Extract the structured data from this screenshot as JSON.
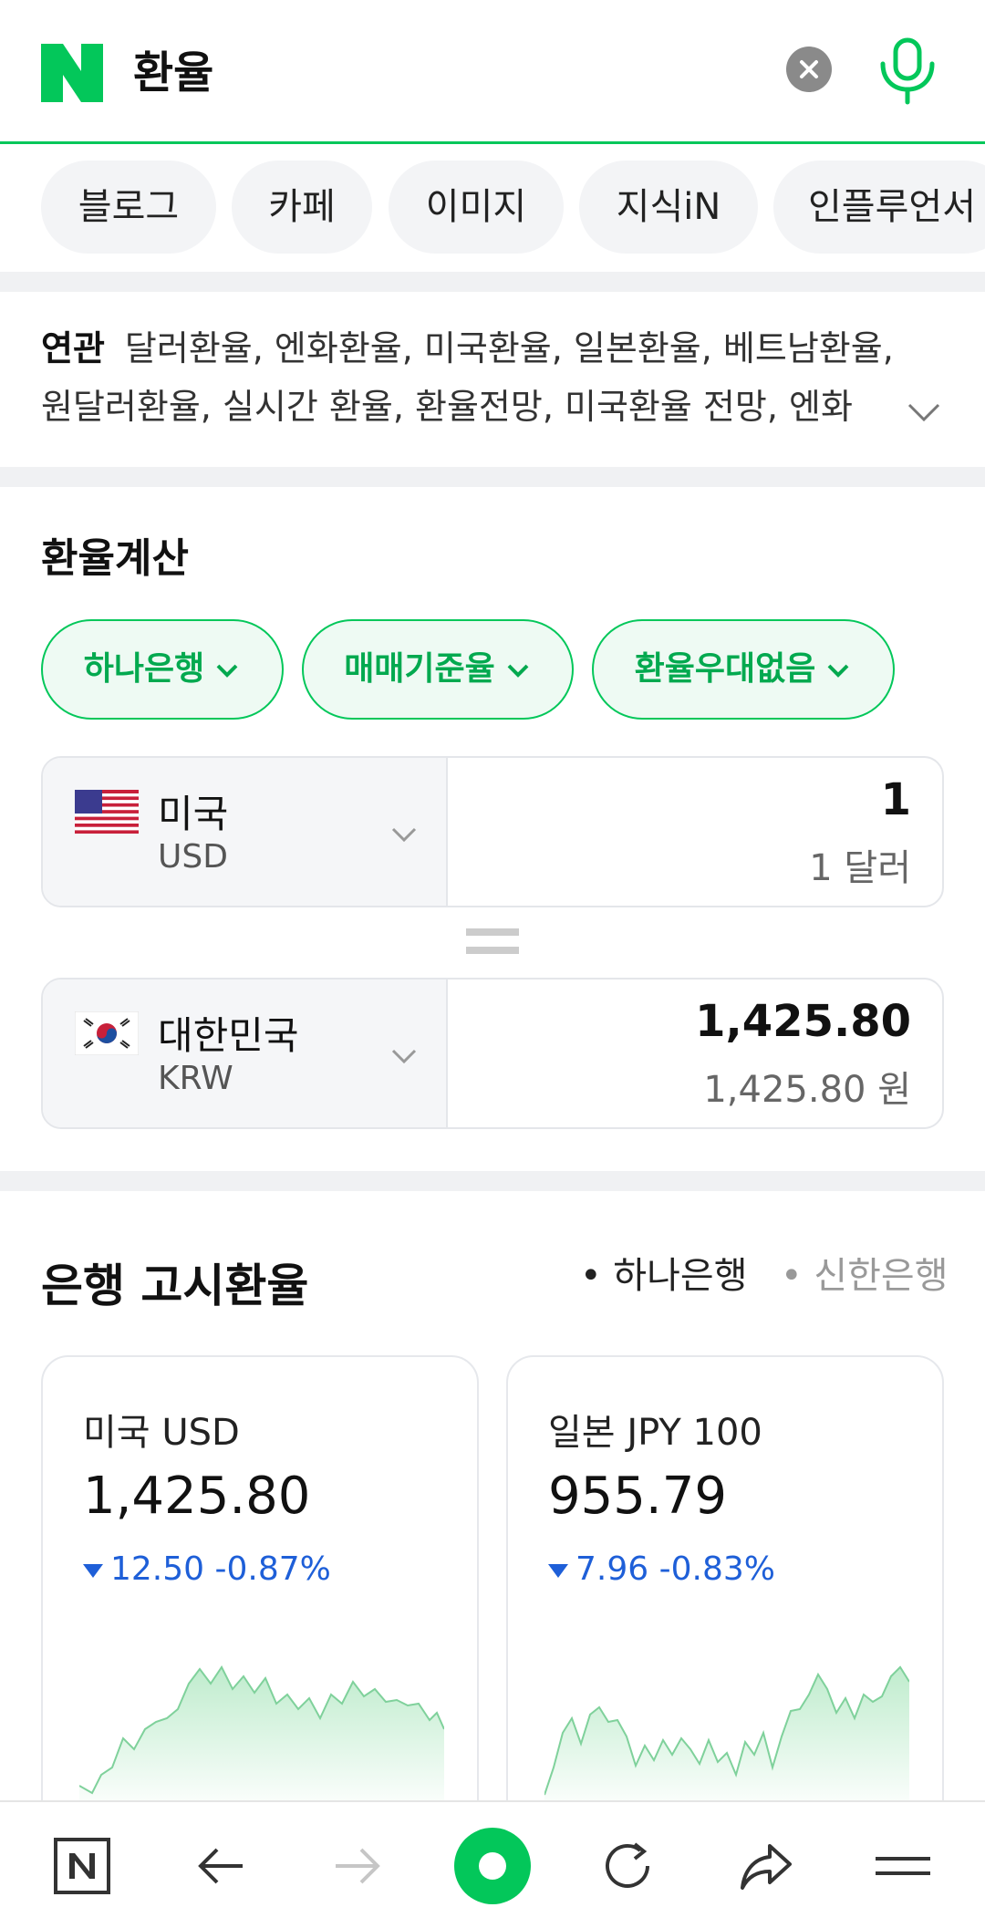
{
  "search": {
    "query": "환율"
  },
  "tabs": [
    "블로그",
    "카페",
    "이미지",
    "지식iN",
    "인플루언서"
  ],
  "related": {
    "label": "연관",
    "line1": "달러환율, 엔화환율, 미국환율, 일본환율, 베트남환율,",
    "line2": "원달러환율, 실시간 환율, 환율전망, 미국환율 전망, 엔화"
  },
  "calculator": {
    "title": "환율계산",
    "options": [
      "하나은행",
      "매매기준율",
      "환율우대없음"
    ],
    "from": {
      "name": "미국",
      "code": "USD",
      "value": "1",
      "text": "1 달러"
    },
    "to": {
      "name": "대한민국",
      "code": "KRW",
      "value": "1,425.80",
      "text": "1,425.80 원"
    }
  },
  "bank_rates": {
    "title": "은행 고시환율",
    "banks": [
      {
        "label": "• 하나은행",
        "active": true
      },
      {
        "label": "• 신한은행",
        "active": false
      }
    ],
    "cards": [
      {
        "label": "미국 USD",
        "value": "1,425.80",
        "change": "12.50 -0.87%",
        "direction": "down"
      },
      {
        "label": "일본 JPY 100",
        "value": "955.79",
        "change": "7.96 -0.83%",
        "direction": "down"
      }
    ]
  },
  "colors": {
    "accent": "#03c75a",
    "down": "#1e5fd8"
  },
  "nav_icons": [
    "naver-home-icon",
    "back-arrow-icon",
    "forward-arrow-icon",
    "green-dot-icon",
    "refresh-icon",
    "share-icon",
    "menu-icon"
  ]
}
